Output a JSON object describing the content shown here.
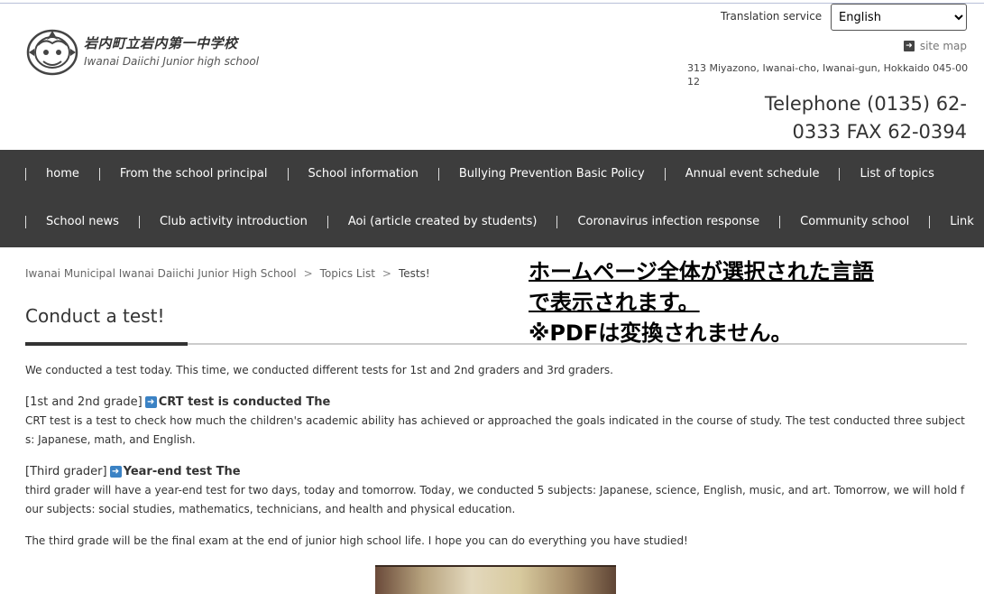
{
  "header": {
    "school_name_jp": "岩内町立岩内第一中学校",
    "school_name_en": "Iwanai Daiichi Junior high school",
    "translation_label": "Translation service",
    "language_selected": "English",
    "sitemap_label": "site map",
    "address": "313 Miyazono, Iwanai-cho, Iwanai-gun, Hokkaido 045-0012",
    "phone": "Telephone (0135) 62-0333 FAX 62-0394"
  },
  "nav": {
    "row1": [
      "home",
      "From the school principal",
      "School information",
      "Bullying Prevention Basic Policy",
      "Annual event schedule",
      "List of topics"
    ],
    "row2": [
      "School news",
      "Club activity introduction",
      "Aoi (article created by students)",
      "Coronavirus infection response",
      "Community school",
      "Link"
    ]
  },
  "breadcrumb": {
    "home": "Iwanai Municipal Iwanai Daiichi Junior High School",
    "list": "Topics List",
    "current": "Tests!",
    "separator": ">"
  },
  "overlay": {
    "line1": "ホームページ全体が選択された言語",
    "line2": "で表示されます。",
    "line3": "※PDFは変換されません。"
  },
  "article": {
    "title": "Conduct a test!",
    "intro": "We conducted a test today. This time, we conducted different tests for 1st and 2nd graders and 3rd graders.",
    "g12_label": "[1st and 2nd grade]",
    "g12_heading": "CRT test is conducted The",
    "g12_body": "CRT test is a test to check how much the children's academic ability has achieved or approached the goals indicated in the course of study. The test conducted three subjects: Japanese, math, and English.",
    "g3_label": "[Third grader]",
    "g3_heading": "Year-end test The",
    "g3_body": "third grader will have a year-end test for two days, today and tomorrow. Today, we conducted 5 subjects: Japanese, science, English, music, and art. Tomorrow, we will hold four subjects: social studies, mathematics, technicians, and health and physical education.",
    "closing": "The third grade will be the final exam at the end of junior high school life. I hope you can do everything you have studied!"
  },
  "icons": {
    "arrow": "right-arrow-icon",
    "logo": "school-emblem-icon",
    "sitemap": "chevron-right-icon"
  },
  "colors": {
    "nav_bg": "#3d3d3d",
    "nav_text": "#ffffff",
    "arrow_icon": "#3b82c4",
    "title_accent": "#333333"
  }
}
